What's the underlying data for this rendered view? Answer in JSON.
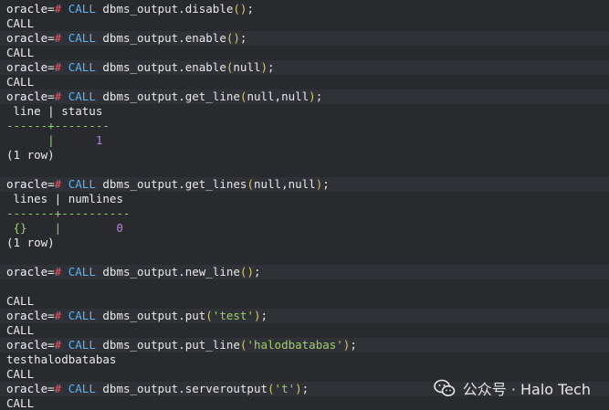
{
  "prompt": "oracle=",
  "hash": "#",
  "keyword": "CALL",
  "lines": [
    {
      "kind": "cmd",
      "fn": "dbms_output.disable",
      "args": "",
      "alt": false
    },
    {
      "kind": "out",
      "text": "CALL",
      "alt": false
    },
    {
      "kind": "cmd",
      "fn": "dbms_output.enable",
      "args": "",
      "alt": true
    },
    {
      "kind": "out",
      "text": "CALL",
      "alt": false
    },
    {
      "kind": "cmd",
      "fn": "dbms_output.enable",
      "args": "null",
      "alt": true
    },
    {
      "kind": "out",
      "text": "CALL",
      "alt": false
    },
    {
      "kind": "cmd",
      "fn": "dbms_output.get_line",
      "args": "null,null",
      "alt": true
    },
    {
      "kind": "out",
      "text": " line | status",
      "alt": false
    },
    {
      "kind": "sep",
      "text": "------+--------",
      "alt": false
    },
    {
      "kind": "row",
      "cells": [
        "      |      ",
        "1"
      ],
      "alt": false
    },
    {
      "kind": "out",
      "text": "(1 row)",
      "alt": false
    },
    {
      "kind": "blank",
      "alt": false
    },
    {
      "kind": "cmd",
      "fn": "dbms_output.get_lines",
      "args": "null,null",
      "alt": true
    },
    {
      "kind": "out",
      "text": " lines | numlines",
      "alt": false
    },
    {
      "kind": "sep",
      "text": "-------+----------",
      "alt": false
    },
    {
      "kind": "row2",
      "cells": [
        " {}",
        "    |        ",
        "0"
      ],
      "alt": false
    },
    {
      "kind": "out",
      "text": "(1 row)",
      "alt": false
    },
    {
      "kind": "blank",
      "alt": false
    },
    {
      "kind": "cmd",
      "fn": "dbms_output.new_line",
      "args": "",
      "alt": true
    },
    {
      "kind": "blank",
      "alt": false
    },
    {
      "kind": "out",
      "text": "CALL",
      "alt": false
    },
    {
      "kind": "cmd",
      "fn": "dbms_output.put",
      "args": "'test'",
      "alt": true
    },
    {
      "kind": "out",
      "text": "CALL",
      "alt": false
    },
    {
      "kind": "cmd",
      "fn": "dbms_output.put_line",
      "args": "'halodbatabas'",
      "alt": true
    },
    {
      "kind": "out",
      "text": "testhalodbatabas",
      "alt": false
    },
    {
      "kind": "out",
      "text": "CALL",
      "alt": false
    },
    {
      "kind": "cmd",
      "fn": "dbms_output.serveroutput",
      "args": "'t'",
      "alt": true
    },
    {
      "kind": "out",
      "text": "CALL",
      "alt": false
    }
  ],
  "watermark": {
    "text": "公众号 · Halo Tech",
    "icon": "wechat-icon"
  }
}
